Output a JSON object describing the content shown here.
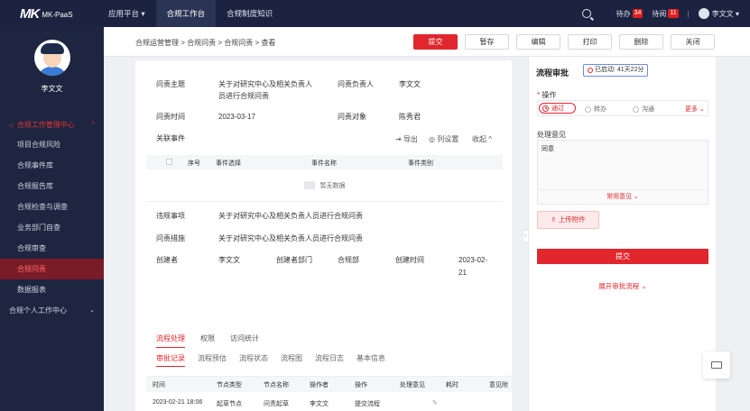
{
  "topbar": {
    "logo_mark": "MK",
    "logo_text": "MK-PaaS",
    "nav": [
      {
        "label": "应用平台 ▾"
      },
      {
        "label": "合规工作台"
      },
      {
        "label": "合规制度知识"
      }
    ],
    "todo_label": "待办",
    "todo_count": "34",
    "pending_label": "待阅",
    "pending_count": "11",
    "separator": "|",
    "user": "李文文 ▾"
  },
  "sidebar": {
    "user_name": "李文文",
    "group1": "合规工作管理中心",
    "items": [
      {
        "label": "项目合规风险"
      },
      {
        "label": "合规事件库"
      },
      {
        "label": "合规报告库"
      },
      {
        "label": "合规检查与调查"
      },
      {
        "label": "业务部门自查"
      },
      {
        "label": "合规审查"
      },
      {
        "label": "合规问责"
      },
      {
        "label": "数据报表"
      }
    ],
    "group2": "合规个人工作中心"
  },
  "breadcrumb": "合规运营管理 > 合规问责 > 合规问责 > 查看",
  "toolbar": {
    "submit": "提交",
    "save": "暂存",
    "edit": "编辑",
    "print": "打印",
    "delete": "删除",
    "close": "关闭"
  },
  "form": {
    "subject_label": "问责主题",
    "subject_value_1": "关于对研究中心及相关负责人",
    "subject_value_2": "员进行合规问责",
    "owner_label": "问责负责人",
    "owner_value": "李文文",
    "time_label": "问责时间",
    "time_value": "2023-03-17",
    "target_label": "问责对象",
    "target_value": "陈秀君",
    "events_label": "关联事件",
    "export": "导出",
    "column_settings": "列设置",
    "collapse": "收起 ^",
    "events_table": {
      "columns": [
        "序号",
        "事件选择",
        "事件名称",
        "事件类别"
      ],
      "empty": "暂无数据"
    },
    "violation_label": "违规事项",
    "violation_value": "关于对研究中心及相关负责人员进行合规问责",
    "measure_label": "问责措施",
    "measure_value": "关于对研究中心及相关负责人员进行合规问责",
    "creator_label": "创建者",
    "creator_value": "李文文",
    "dept_label": "创建者部门",
    "dept_value": "合规部",
    "created_label": "创建时间",
    "created_value_1": "2023-02-",
    "created_value_2": "21"
  },
  "tabs_main": [
    {
      "label": "流程处理"
    },
    {
      "label": "权限"
    },
    {
      "label": "访问统计"
    }
  ],
  "tabs_sub": [
    {
      "label": "审批记录"
    },
    {
      "label": "流程预估"
    },
    {
      "label": "流程状态"
    },
    {
      "label": "流程图"
    },
    {
      "label": "流程日志"
    },
    {
      "label": "基本信息"
    }
  ],
  "records": {
    "columns": [
      "时间",
      "节点类型",
      "节点名称",
      "操作者",
      "操作",
      "处理意见",
      "耗时",
      "意见附"
    ],
    "rows": [
      {
        "time": "2023-02-21 18:06",
        "node_type": "起草节点",
        "node_name": "问责起草",
        "operator": "李文文",
        "action": "提交流程"
      }
    ]
  },
  "approval": {
    "title": "流程审批",
    "timer": "已启动: 41天22分",
    "operation_label": "操作",
    "options": [
      {
        "label": "通过"
      },
      {
        "label": "转办"
      },
      {
        "label": "沟通"
      }
    ],
    "more": "更多 ⌄",
    "opinion_label": "处理意见",
    "opinion_value": "同意",
    "common_opinion": "常用意见 ⌄",
    "upload": "上传附件",
    "submit": "提交",
    "expand": "展开审批流程 ⌄"
  }
}
